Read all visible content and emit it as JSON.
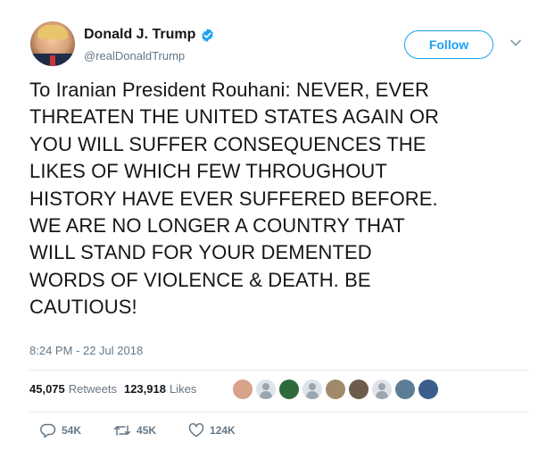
{
  "user": {
    "display_name": "Donald J. Trump",
    "handle": "@realDonaldTrump",
    "verified_icon": "verified-badge-icon"
  },
  "follow_button": {
    "label": "Follow"
  },
  "tweet": {
    "lines": [
      "To Iranian President Rouhani: NEVER, EVER",
      "THREATEN THE UNITED STATES AGAIN OR",
      "YOU WILL SUFFER CONSEQUENCES THE",
      "LIKES OF WHICH FEW THROUGHOUT",
      "HISTORY HAVE EVER SUFFERED BEFORE.",
      "WE ARE NO LONGER A COUNTRY THAT",
      "WILL STAND FOR YOUR DEMENTED",
      "WORDS OF VIOLENCE & DEATH. BE",
      "CAUTIOUS!"
    ],
    "timestamp": "8:24 PM - 22 Jul 2018"
  },
  "stats": {
    "retweets_count": "45,075",
    "retweets_label": "Retweets",
    "likes_count": "123,918",
    "likes_label": "Likes"
  },
  "liker_avatars": [
    {
      "name": "liker-avatar-1",
      "color": "#d9a28a"
    },
    {
      "name": "liker-avatar-2",
      "color": "#dde3e8"
    },
    {
      "name": "liker-avatar-3",
      "color": "#2f6b3a"
    },
    {
      "name": "liker-avatar-4",
      "color": "#dde3e8"
    },
    {
      "name": "liker-avatar-5",
      "color": "#a08a6c"
    },
    {
      "name": "liker-avatar-6",
      "color": "#6d5b4b"
    },
    {
      "name": "liker-avatar-7",
      "color": "#dde3e8"
    },
    {
      "name": "liker-avatar-8",
      "color": "#5c7d95"
    },
    {
      "name": "liker-avatar-9",
      "color": "#3b5f8a"
    }
  ],
  "actions": {
    "reply_count": "54K",
    "retweet_count": "45K",
    "like_count": "124K"
  },
  "colors": {
    "accent": "#1da1f2",
    "secondary_text": "#657786",
    "primary_text": "#14171a"
  }
}
